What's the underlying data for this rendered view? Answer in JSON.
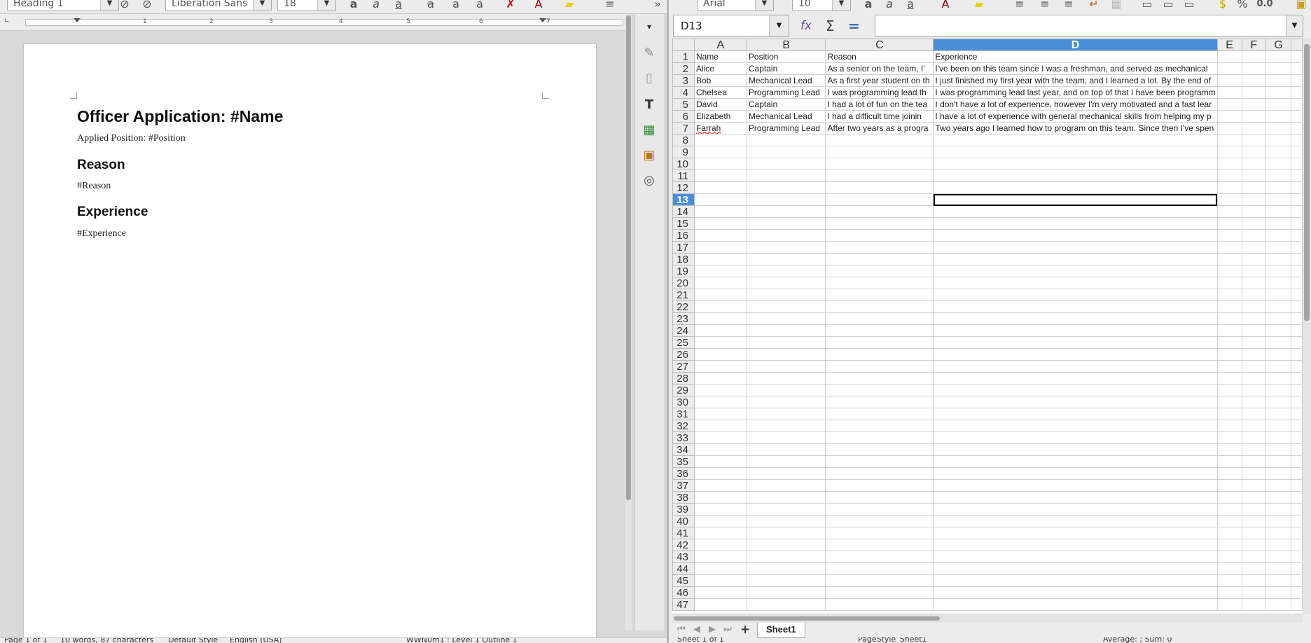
{
  "writer": {
    "toolbar": {
      "paragraph_style": "Heading 1",
      "font_name": "Liberation Sans",
      "font_size": "18"
    },
    "document": {
      "title": "Officer Application: #Name",
      "applied_position": "Applied Position: #Position",
      "reason_heading": "Reason",
      "reason_body": "#Reason",
      "experience_heading": "Experience",
      "experience_body": "#Experience"
    },
    "ruler_numbers": [
      "1",
      "2",
      "3",
      "4",
      "5",
      "6",
      "7"
    ],
    "status": {
      "page": "Page 1 of 1",
      "words": "10 words, 87 characters",
      "style": "Default Style",
      "language": "English (USA)",
      "outline": "WWNum1 : Level 1    Outline 1"
    }
  },
  "calc": {
    "toolbar": {
      "font_name": "Arial",
      "font_size": "10",
      "number_format": "0.0"
    },
    "name_box": "D13",
    "formula_value": "",
    "columns": [
      "A",
      "B",
      "C",
      "D",
      "E",
      "F",
      "G"
    ],
    "selected_column": "D",
    "selected_row": 13,
    "row_count": 47,
    "rows": [
      [
        "Name",
        "Position",
        "Reason",
        "Experience"
      ],
      [
        "Alice",
        "Captain",
        "As a senior on the team, I'",
        "I've been on this team since I was a freshman, and served as mechanical"
      ],
      [
        "Bob",
        "Mechanical Lead",
        "As a first year student on th",
        "I just finished my first year with the team, and I learned a lot. By the end of"
      ],
      [
        "Chelsea",
        "Programming Lead",
        "I was programming lead th",
        "I was programming lead last year, and on top of that I have been programm"
      ],
      [
        "David",
        "Captain",
        "I had a lot of fun on the tea",
        "I don't have a lot of experience, however I'm very motivated and a fast lear"
      ],
      [
        "Elizabeth",
        "Mechanical Lead",
        "I had a difficult time joinin",
        "I have a lot of experience with general mechanical skills from helping my p"
      ],
      [
        "Farrah",
        "Programming Lead",
        "After two years as a progra",
        "Two years ago I learned how to program on this team. Since then I've spen"
      ]
    ],
    "sheet_tab": "Sheet1",
    "status": {
      "sheet": "Sheet 1 of 1",
      "page_style": "PageStyle_Sheet1",
      "aggregate": "Average: ; Sum: 0"
    }
  }
}
